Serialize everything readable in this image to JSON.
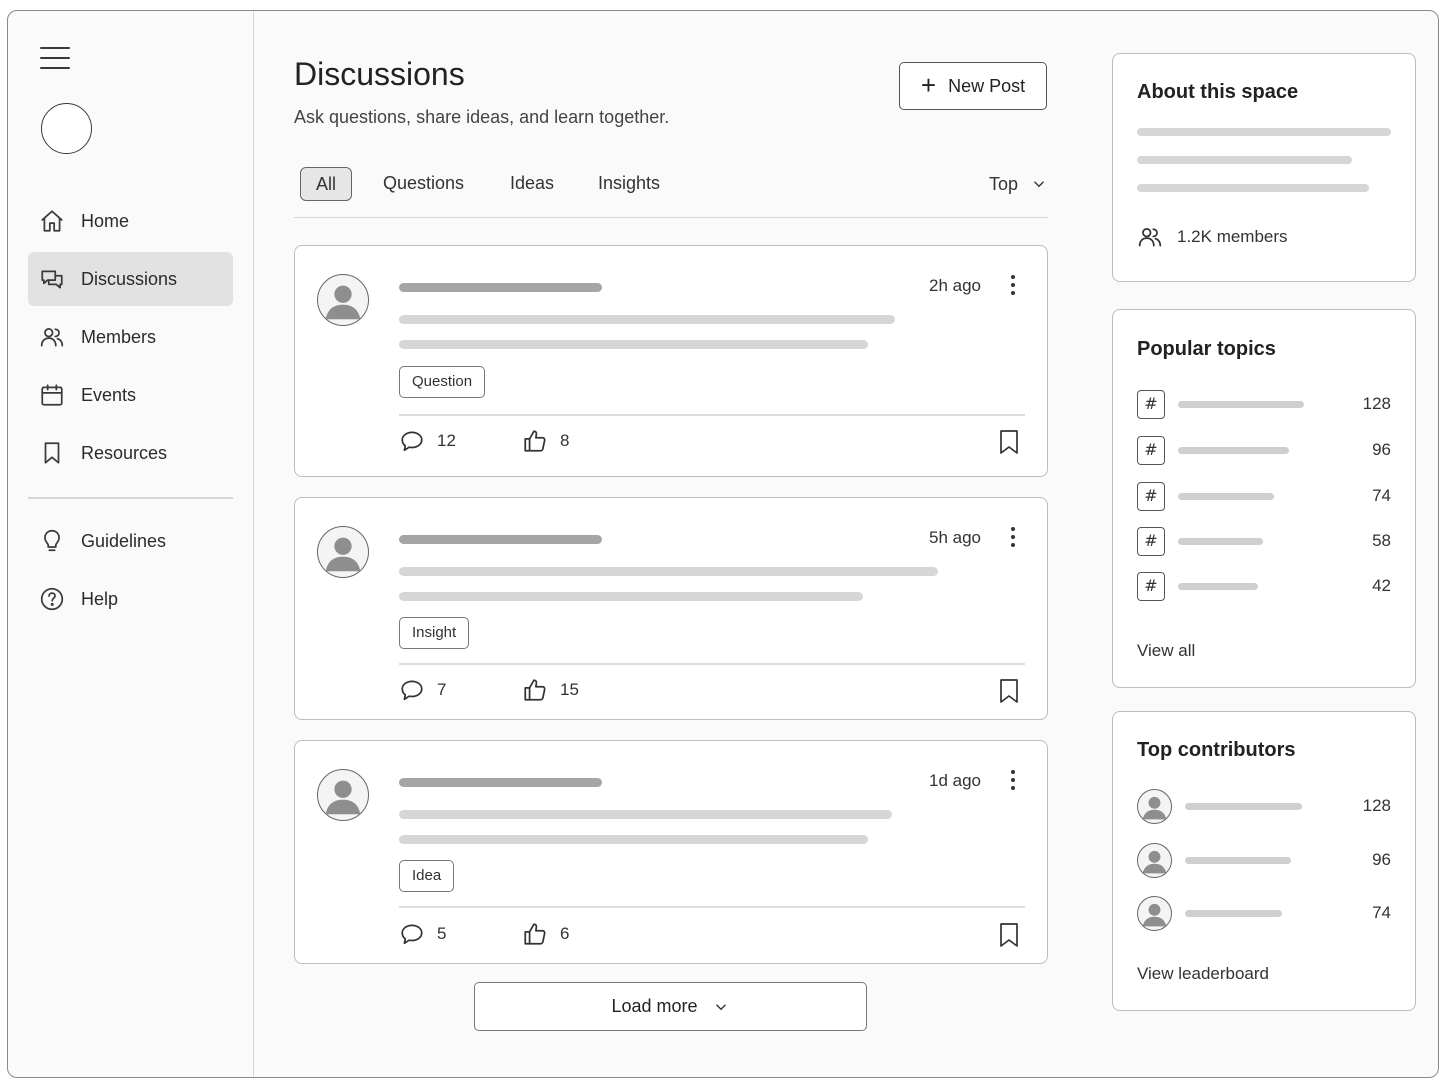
{
  "sidebar": {
    "menu_icon": "hamburger-menu-icon",
    "logo_icon": "circle-logo",
    "items": [
      {
        "label": "Home",
        "icon": "home-icon",
        "active": false
      },
      {
        "label": "Discussions",
        "icon": "chat-bubbles-icon",
        "active": true
      },
      {
        "label": "Members",
        "icon": "users-icon",
        "active": false
      },
      {
        "label": "Events",
        "icon": "calendar-icon",
        "active": false
      },
      {
        "label": "Resources",
        "icon": "bookmark-icon",
        "active": false
      }
    ],
    "secondary": [
      {
        "label": "Guidelines",
        "icon": "lightbulb-icon"
      },
      {
        "label": "Help",
        "icon": "help-circle-icon"
      }
    ]
  },
  "main": {
    "title": "Discussions",
    "subtitle": "Ask questions, share ideas, and learn together.",
    "new_post_label": "New Post",
    "tabs": [
      {
        "label": "All",
        "active": true
      },
      {
        "label": "Questions",
        "active": false
      },
      {
        "label": "Ideas",
        "active": false
      },
      {
        "label": "Insights",
        "active": false
      }
    ],
    "sort_label": "Top",
    "posts": [
      {
        "time": "2h ago",
        "tag": "Question",
        "comments": "12",
        "likes": "8"
      },
      {
        "time": "5h ago",
        "tag": "Insight",
        "comments": "7",
        "likes": "15"
      },
      {
        "time": "1d ago",
        "tag": "Idea",
        "comments": "5",
        "likes": "6"
      }
    ],
    "load_more_label": "Load more"
  },
  "about": {
    "title": "About this space",
    "members": "1.2K members"
  },
  "topics": {
    "title": "Popular topics",
    "hash_symbol": "#",
    "counts": [
      "128",
      "96",
      "74",
      "58",
      "42"
    ],
    "view_all": "View all"
  },
  "contributors": {
    "title": "Top contributors",
    "counts": [
      "128",
      "96",
      "74"
    ],
    "view_leaderboard": "View leaderboard"
  },
  "colors": {
    "background": "#fafafa",
    "active_nav": "#e2e2e2",
    "placeholder_dark": "#a5a5a5",
    "placeholder_light": "#d6d6d6"
  }
}
